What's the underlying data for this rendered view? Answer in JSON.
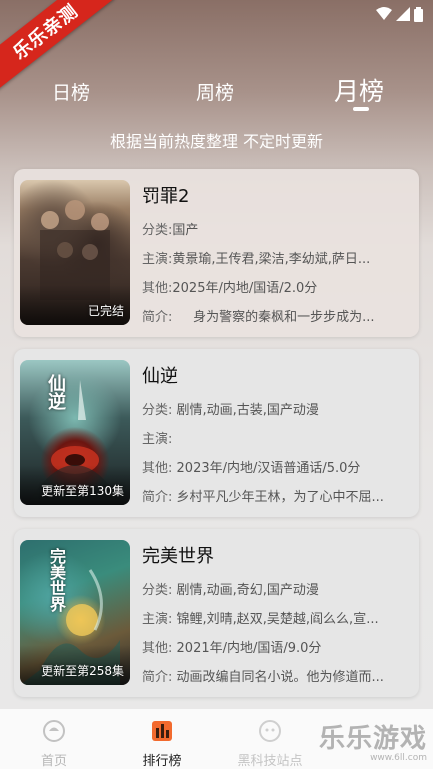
{
  "ribbon": "乐乐亲测",
  "tabs": {
    "day": "日榜",
    "week": "周榜",
    "month": "月榜"
  },
  "subtitle": "根据当前热度整理 不定时更新",
  "labels": {
    "category": "分类:",
    "cast": "主演:",
    "other": "其他:",
    "intro": "简介:"
  },
  "items": [
    {
      "title": "罚罪2",
      "category": "国产",
      "cast": "黄景瑜,王传君,梁洁,李幼斌,萨日...",
      "other": "2025年/内地/国语/2.0分",
      "intro": "身为警察的秦枫和一步步成为...",
      "badge": "已完结"
    },
    {
      "title": "仙逆",
      "category": "剧情,动画,古装,国产动漫",
      "cast": "",
      "other": "2023年/内地/汉语普通话/5.0分",
      "intro": "乡村平凡少年王林，为了心中不屈...",
      "badge": "更新至第130集",
      "poster_text": "仙逆"
    },
    {
      "title": "完美世界",
      "category": "剧情,动画,奇幻,国产动漫",
      "cast": "锦鲤,刘晴,赵双,吴楚越,阎么么,宣...",
      "other": "2021年/内地/国语/9.0分",
      "intro": "动画改编自同名小说。他为修道而...",
      "badge": "更新至第258集",
      "poster_text": "完美世界"
    }
  ],
  "nav": {
    "home": "首页",
    "rank": "排行榜",
    "tech": "黑科技站点"
  },
  "watermark": {
    "brand": "乐乐游戏",
    "url": "www.6ll.com"
  }
}
